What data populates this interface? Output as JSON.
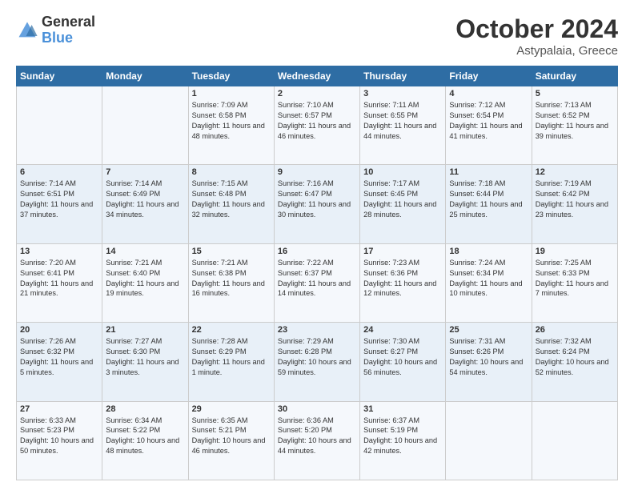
{
  "header": {
    "logo_line1": "General",
    "logo_line2": "Blue",
    "month": "October 2024",
    "location": "Astypalaia, Greece"
  },
  "days_of_week": [
    "Sunday",
    "Monday",
    "Tuesday",
    "Wednesday",
    "Thursday",
    "Friday",
    "Saturday"
  ],
  "weeks": [
    [
      {
        "day": "",
        "sunrise": "",
        "sunset": "",
        "daylight": ""
      },
      {
        "day": "",
        "sunrise": "",
        "sunset": "",
        "daylight": ""
      },
      {
        "day": "1",
        "sunrise": "Sunrise: 7:09 AM",
        "sunset": "Sunset: 6:58 PM",
        "daylight": "Daylight: 11 hours and 48 minutes."
      },
      {
        "day": "2",
        "sunrise": "Sunrise: 7:10 AM",
        "sunset": "Sunset: 6:57 PM",
        "daylight": "Daylight: 11 hours and 46 minutes."
      },
      {
        "day": "3",
        "sunrise": "Sunrise: 7:11 AM",
        "sunset": "Sunset: 6:55 PM",
        "daylight": "Daylight: 11 hours and 44 minutes."
      },
      {
        "day": "4",
        "sunrise": "Sunrise: 7:12 AM",
        "sunset": "Sunset: 6:54 PM",
        "daylight": "Daylight: 11 hours and 41 minutes."
      },
      {
        "day": "5",
        "sunrise": "Sunrise: 7:13 AM",
        "sunset": "Sunset: 6:52 PM",
        "daylight": "Daylight: 11 hours and 39 minutes."
      }
    ],
    [
      {
        "day": "6",
        "sunrise": "Sunrise: 7:14 AM",
        "sunset": "Sunset: 6:51 PM",
        "daylight": "Daylight: 11 hours and 37 minutes."
      },
      {
        "day": "7",
        "sunrise": "Sunrise: 7:14 AM",
        "sunset": "Sunset: 6:49 PM",
        "daylight": "Daylight: 11 hours and 34 minutes."
      },
      {
        "day": "8",
        "sunrise": "Sunrise: 7:15 AM",
        "sunset": "Sunset: 6:48 PM",
        "daylight": "Daylight: 11 hours and 32 minutes."
      },
      {
        "day": "9",
        "sunrise": "Sunrise: 7:16 AM",
        "sunset": "Sunset: 6:47 PM",
        "daylight": "Daylight: 11 hours and 30 minutes."
      },
      {
        "day": "10",
        "sunrise": "Sunrise: 7:17 AM",
        "sunset": "Sunset: 6:45 PM",
        "daylight": "Daylight: 11 hours and 28 minutes."
      },
      {
        "day": "11",
        "sunrise": "Sunrise: 7:18 AM",
        "sunset": "Sunset: 6:44 PM",
        "daylight": "Daylight: 11 hours and 25 minutes."
      },
      {
        "day": "12",
        "sunrise": "Sunrise: 7:19 AM",
        "sunset": "Sunset: 6:42 PM",
        "daylight": "Daylight: 11 hours and 23 minutes."
      }
    ],
    [
      {
        "day": "13",
        "sunrise": "Sunrise: 7:20 AM",
        "sunset": "Sunset: 6:41 PM",
        "daylight": "Daylight: 11 hours and 21 minutes."
      },
      {
        "day": "14",
        "sunrise": "Sunrise: 7:21 AM",
        "sunset": "Sunset: 6:40 PM",
        "daylight": "Daylight: 11 hours and 19 minutes."
      },
      {
        "day": "15",
        "sunrise": "Sunrise: 7:21 AM",
        "sunset": "Sunset: 6:38 PM",
        "daylight": "Daylight: 11 hours and 16 minutes."
      },
      {
        "day": "16",
        "sunrise": "Sunrise: 7:22 AM",
        "sunset": "Sunset: 6:37 PM",
        "daylight": "Daylight: 11 hours and 14 minutes."
      },
      {
        "day": "17",
        "sunrise": "Sunrise: 7:23 AM",
        "sunset": "Sunset: 6:36 PM",
        "daylight": "Daylight: 11 hours and 12 minutes."
      },
      {
        "day": "18",
        "sunrise": "Sunrise: 7:24 AM",
        "sunset": "Sunset: 6:34 PM",
        "daylight": "Daylight: 11 hours and 10 minutes."
      },
      {
        "day": "19",
        "sunrise": "Sunrise: 7:25 AM",
        "sunset": "Sunset: 6:33 PM",
        "daylight": "Daylight: 11 hours and 7 minutes."
      }
    ],
    [
      {
        "day": "20",
        "sunrise": "Sunrise: 7:26 AM",
        "sunset": "Sunset: 6:32 PM",
        "daylight": "Daylight: 11 hours and 5 minutes."
      },
      {
        "day": "21",
        "sunrise": "Sunrise: 7:27 AM",
        "sunset": "Sunset: 6:30 PM",
        "daylight": "Daylight: 11 hours and 3 minutes."
      },
      {
        "day": "22",
        "sunrise": "Sunrise: 7:28 AM",
        "sunset": "Sunset: 6:29 PM",
        "daylight": "Daylight: 11 hours and 1 minute."
      },
      {
        "day": "23",
        "sunrise": "Sunrise: 7:29 AM",
        "sunset": "Sunset: 6:28 PM",
        "daylight": "Daylight: 10 hours and 59 minutes."
      },
      {
        "day": "24",
        "sunrise": "Sunrise: 7:30 AM",
        "sunset": "Sunset: 6:27 PM",
        "daylight": "Daylight: 10 hours and 56 minutes."
      },
      {
        "day": "25",
        "sunrise": "Sunrise: 7:31 AM",
        "sunset": "Sunset: 6:26 PM",
        "daylight": "Daylight: 10 hours and 54 minutes."
      },
      {
        "day": "26",
        "sunrise": "Sunrise: 7:32 AM",
        "sunset": "Sunset: 6:24 PM",
        "daylight": "Daylight: 10 hours and 52 minutes."
      }
    ],
    [
      {
        "day": "27",
        "sunrise": "Sunrise: 6:33 AM",
        "sunset": "Sunset: 5:23 PM",
        "daylight": "Daylight: 10 hours and 50 minutes."
      },
      {
        "day": "28",
        "sunrise": "Sunrise: 6:34 AM",
        "sunset": "Sunset: 5:22 PM",
        "daylight": "Daylight: 10 hours and 48 minutes."
      },
      {
        "day": "29",
        "sunrise": "Sunrise: 6:35 AM",
        "sunset": "Sunset: 5:21 PM",
        "daylight": "Daylight: 10 hours and 46 minutes."
      },
      {
        "day": "30",
        "sunrise": "Sunrise: 6:36 AM",
        "sunset": "Sunset: 5:20 PM",
        "daylight": "Daylight: 10 hours and 44 minutes."
      },
      {
        "day": "31",
        "sunrise": "Sunrise: 6:37 AM",
        "sunset": "Sunset: 5:19 PM",
        "daylight": "Daylight: 10 hours and 42 minutes."
      },
      {
        "day": "",
        "sunrise": "",
        "sunset": "",
        "daylight": ""
      },
      {
        "day": "",
        "sunrise": "",
        "sunset": "",
        "daylight": ""
      }
    ]
  ]
}
